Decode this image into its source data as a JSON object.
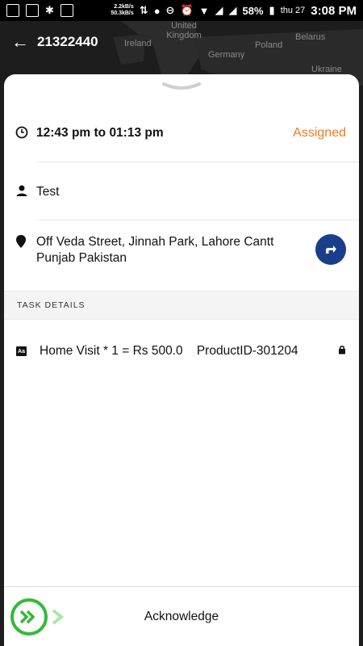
{
  "status_bar": {
    "net_down": "2.2kB/s",
    "net_up": "50.3kB/s",
    "battery": "58%",
    "date": "thu 27",
    "time": "3:08 PM"
  },
  "map": {
    "labels": [
      "United Kingdom",
      "Ireland",
      "Belarus",
      "Germany",
      "Poland",
      "Ukraine"
    ]
  },
  "appbar": {
    "task_id": "21322440",
    "back_icon": "back-arrow-icon"
  },
  "task": {
    "time_range": "12:43 pm to 01:13 pm",
    "status": "Assigned",
    "customer_name": "Test",
    "address": "Off Veda Street, Jinnah Park, Lahore Cantt Punjab Pakistan",
    "section_title": "TASK DETAILS",
    "detail": "Home Visit * 1 = Rs 500.0    ProductID-301204"
  },
  "bottom": {
    "acknowledge_label": "Acknowledge"
  },
  "colors": {
    "status": "#f07b1f",
    "nav_button": "#1a3e8a",
    "slider_green": "#34b93a"
  }
}
